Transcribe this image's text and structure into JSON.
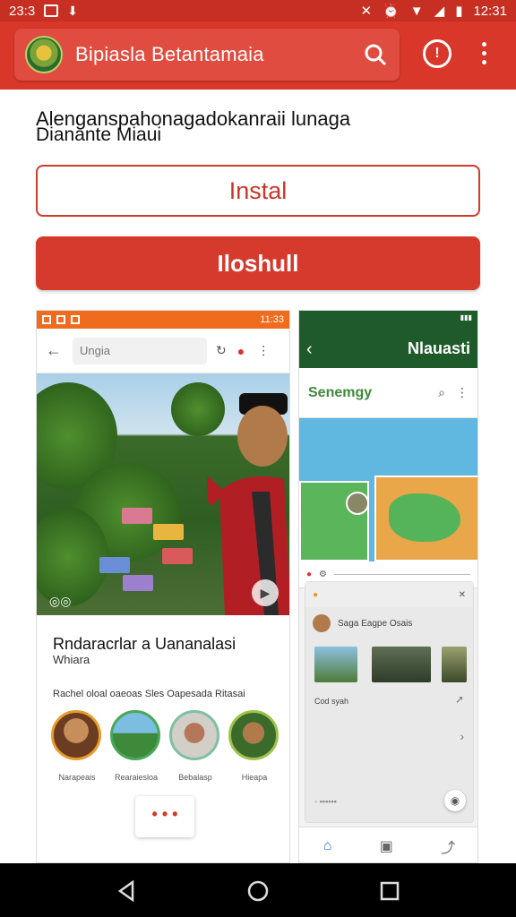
{
  "status_bar": {
    "time_left": "23:3",
    "time_right": "12:31"
  },
  "app_bar": {
    "title": "Bipiasla Betantamaia"
  },
  "heading": {
    "line1": "Alenganspahonagadokanraii lunaga",
    "line2": "Dianante Miaui"
  },
  "buttons": {
    "install_outline": "Instal",
    "install_filled": "Iloshull"
  },
  "screenshot_left": {
    "status_time": "11:33",
    "search_placeholder": "Ungia",
    "title": "Rndaracrlar a Uananalasi",
    "subtitle": "Whiara",
    "caption": "Rachel oloal oaeoas Sles Oapesada Ritasai",
    "avatars": [
      {
        "label": "Narapeais"
      },
      {
        "label": "Rearaiesloa"
      },
      {
        "label": "Bebalasp"
      },
      {
        "label": "Hieapa"
      }
    ],
    "more_label": "• • •"
  },
  "screenshot_right": {
    "title": "Nlauasti",
    "brand": "Senemgy",
    "card_title": "Saga Eagpe Osais",
    "card_row": "Cod syah"
  },
  "colors": {
    "primary": "#d8372a",
    "primary_dark": "#c62f22",
    "green": "#1f5a2a"
  }
}
